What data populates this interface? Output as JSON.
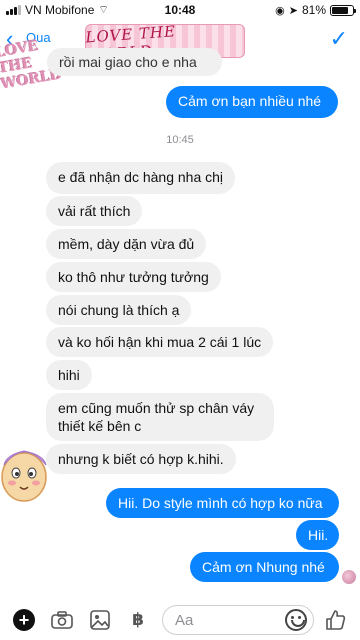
{
  "status_bar": {
    "carrier": "VN Mobifone",
    "time": "10:48",
    "battery": "81%",
    "battery_level": 0.81
  },
  "header": {
    "contact_name": "Qua",
    "banner_text": "LOVE THE WORLD",
    "sticker_text": "LOVE THE WORLD"
  },
  "messages_top": [
    {
      "text": "rồi mai giao cho e nha",
      "dir": "in"
    },
    {
      "text": "Cảm ơn bạn nhiều nhé",
      "dir": "out"
    }
  ],
  "timestamp": "10:45",
  "messages": [
    {
      "text": "e đã nhận dc hàng nha chị",
      "dir": "in"
    },
    {
      "text": "vải rất thích",
      "dir": "in"
    },
    {
      "text": "mềm, dày dặn vừa đủ",
      "dir": "in"
    },
    {
      "text": "ko thô như tưởng tưởng",
      "dir": "in"
    },
    {
      "text": "nói chung là thích ạ",
      "dir": "in"
    },
    {
      "text": "và ko hối hận khi mua 2 cái 1 lúc",
      "dir": "in"
    },
    {
      "text": "hihi",
      "dir": "in"
    },
    {
      "text": "em cũng muốn thử sp chân váy thiết kế bên c",
      "dir": "in"
    },
    {
      "text": "nhưng k biết có hợp k.hihi.",
      "dir": "in"
    },
    {
      "text": "Hii. Do style mình có hợp ko nữa",
      "dir": "out"
    },
    {
      "text": "Hii.",
      "dir": "out"
    },
    {
      "text": "Cảm ơn Nhung nhé",
      "dir": "out"
    }
  ],
  "composer": {
    "placeholder": "Aa"
  }
}
